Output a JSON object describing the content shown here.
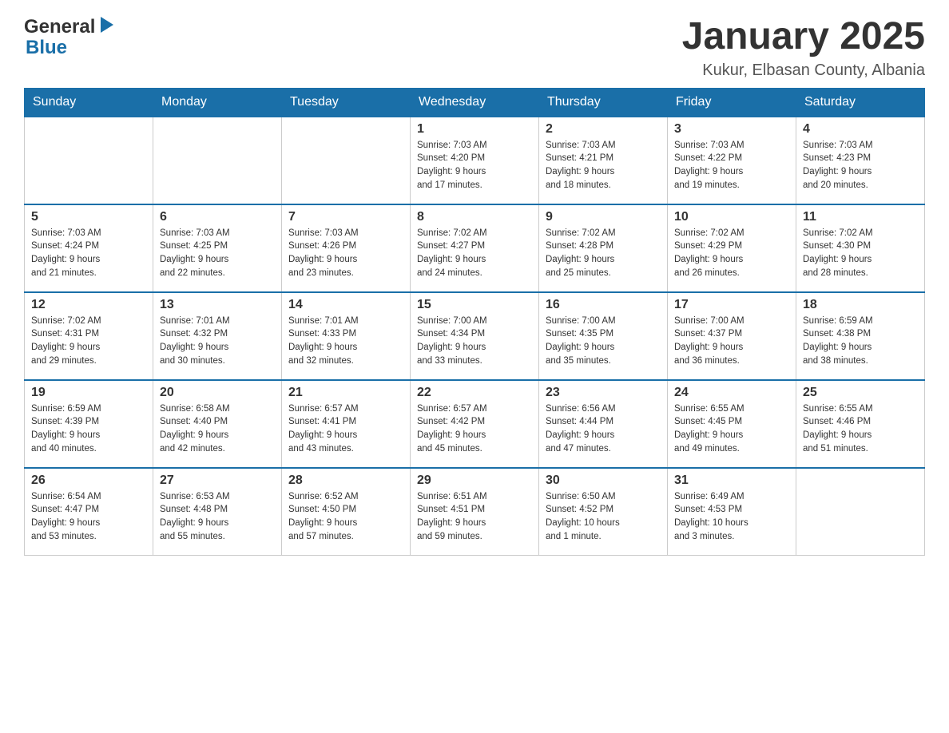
{
  "logo": {
    "general": "General",
    "blue": "Blue"
  },
  "header": {
    "title": "January 2025",
    "subtitle": "Kukur, Elbasan County, Albania"
  },
  "weekdays": [
    "Sunday",
    "Monday",
    "Tuesday",
    "Wednesday",
    "Thursday",
    "Friday",
    "Saturday"
  ],
  "weeks": [
    [
      {
        "day": "",
        "info": ""
      },
      {
        "day": "",
        "info": ""
      },
      {
        "day": "",
        "info": ""
      },
      {
        "day": "1",
        "info": "Sunrise: 7:03 AM\nSunset: 4:20 PM\nDaylight: 9 hours\nand 17 minutes."
      },
      {
        "day": "2",
        "info": "Sunrise: 7:03 AM\nSunset: 4:21 PM\nDaylight: 9 hours\nand 18 minutes."
      },
      {
        "day": "3",
        "info": "Sunrise: 7:03 AM\nSunset: 4:22 PM\nDaylight: 9 hours\nand 19 minutes."
      },
      {
        "day": "4",
        "info": "Sunrise: 7:03 AM\nSunset: 4:23 PM\nDaylight: 9 hours\nand 20 minutes."
      }
    ],
    [
      {
        "day": "5",
        "info": "Sunrise: 7:03 AM\nSunset: 4:24 PM\nDaylight: 9 hours\nand 21 minutes."
      },
      {
        "day": "6",
        "info": "Sunrise: 7:03 AM\nSunset: 4:25 PM\nDaylight: 9 hours\nand 22 minutes."
      },
      {
        "day": "7",
        "info": "Sunrise: 7:03 AM\nSunset: 4:26 PM\nDaylight: 9 hours\nand 23 minutes."
      },
      {
        "day": "8",
        "info": "Sunrise: 7:02 AM\nSunset: 4:27 PM\nDaylight: 9 hours\nand 24 minutes."
      },
      {
        "day": "9",
        "info": "Sunrise: 7:02 AM\nSunset: 4:28 PM\nDaylight: 9 hours\nand 25 minutes."
      },
      {
        "day": "10",
        "info": "Sunrise: 7:02 AM\nSunset: 4:29 PM\nDaylight: 9 hours\nand 26 minutes."
      },
      {
        "day": "11",
        "info": "Sunrise: 7:02 AM\nSunset: 4:30 PM\nDaylight: 9 hours\nand 28 minutes."
      }
    ],
    [
      {
        "day": "12",
        "info": "Sunrise: 7:02 AM\nSunset: 4:31 PM\nDaylight: 9 hours\nand 29 minutes."
      },
      {
        "day": "13",
        "info": "Sunrise: 7:01 AM\nSunset: 4:32 PM\nDaylight: 9 hours\nand 30 minutes."
      },
      {
        "day": "14",
        "info": "Sunrise: 7:01 AM\nSunset: 4:33 PM\nDaylight: 9 hours\nand 32 minutes."
      },
      {
        "day": "15",
        "info": "Sunrise: 7:00 AM\nSunset: 4:34 PM\nDaylight: 9 hours\nand 33 minutes."
      },
      {
        "day": "16",
        "info": "Sunrise: 7:00 AM\nSunset: 4:35 PM\nDaylight: 9 hours\nand 35 minutes."
      },
      {
        "day": "17",
        "info": "Sunrise: 7:00 AM\nSunset: 4:37 PM\nDaylight: 9 hours\nand 36 minutes."
      },
      {
        "day": "18",
        "info": "Sunrise: 6:59 AM\nSunset: 4:38 PM\nDaylight: 9 hours\nand 38 minutes."
      }
    ],
    [
      {
        "day": "19",
        "info": "Sunrise: 6:59 AM\nSunset: 4:39 PM\nDaylight: 9 hours\nand 40 minutes."
      },
      {
        "day": "20",
        "info": "Sunrise: 6:58 AM\nSunset: 4:40 PM\nDaylight: 9 hours\nand 42 minutes."
      },
      {
        "day": "21",
        "info": "Sunrise: 6:57 AM\nSunset: 4:41 PM\nDaylight: 9 hours\nand 43 minutes."
      },
      {
        "day": "22",
        "info": "Sunrise: 6:57 AM\nSunset: 4:42 PM\nDaylight: 9 hours\nand 45 minutes."
      },
      {
        "day": "23",
        "info": "Sunrise: 6:56 AM\nSunset: 4:44 PM\nDaylight: 9 hours\nand 47 minutes."
      },
      {
        "day": "24",
        "info": "Sunrise: 6:55 AM\nSunset: 4:45 PM\nDaylight: 9 hours\nand 49 minutes."
      },
      {
        "day": "25",
        "info": "Sunrise: 6:55 AM\nSunset: 4:46 PM\nDaylight: 9 hours\nand 51 minutes."
      }
    ],
    [
      {
        "day": "26",
        "info": "Sunrise: 6:54 AM\nSunset: 4:47 PM\nDaylight: 9 hours\nand 53 minutes."
      },
      {
        "day": "27",
        "info": "Sunrise: 6:53 AM\nSunset: 4:48 PM\nDaylight: 9 hours\nand 55 minutes."
      },
      {
        "day": "28",
        "info": "Sunrise: 6:52 AM\nSunset: 4:50 PM\nDaylight: 9 hours\nand 57 minutes."
      },
      {
        "day": "29",
        "info": "Sunrise: 6:51 AM\nSunset: 4:51 PM\nDaylight: 9 hours\nand 59 minutes."
      },
      {
        "day": "30",
        "info": "Sunrise: 6:50 AM\nSunset: 4:52 PM\nDaylight: 10 hours\nand 1 minute."
      },
      {
        "day": "31",
        "info": "Sunrise: 6:49 AM\nSunset: 4:53 PM\nDaylight: 10 hours\nand 3 minutes."
      },
      {
        "day": "",
        "info": ""
      }
    ]
  ]
}
